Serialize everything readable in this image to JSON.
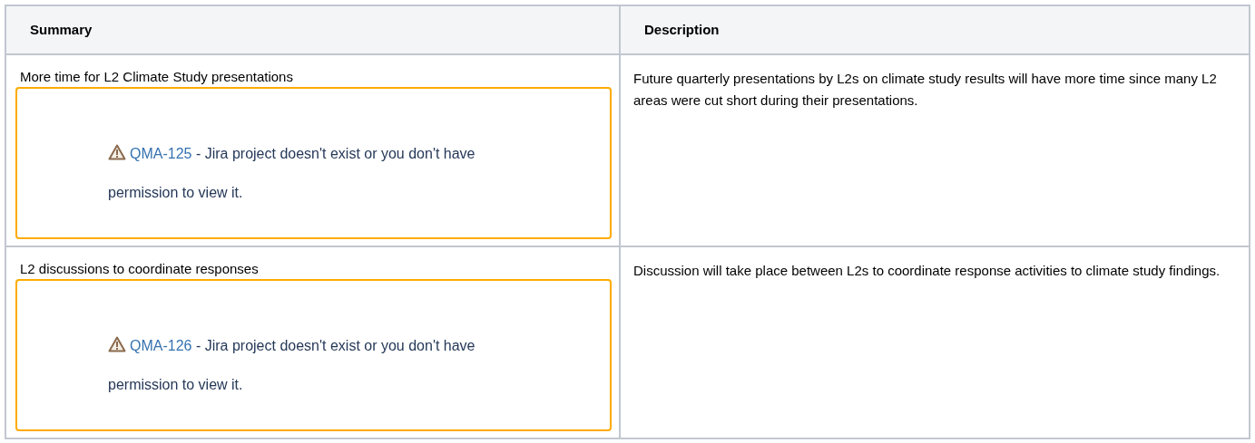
{
  "table": {
    "columns": [
      "Summary",
      "Description"
    ],
    "rows": [
      {
        "summary": "More time for L2 Climate Study presentations",
        "issue": {
          "key": "QMA-125",
          "message": " - Jira project doesn't exist or you don't have permission to view it."
        },
        "description": "Future quarterly presentations by L2s on climate study results will have more time since many L2 areas were cut short during their presentations."
      },
      {
        "summary": "L2 discussions to coordinate responses",
        "issue": {
          "key": "QMA-126",
          "message": " - Jira project doesn't exist or you don't have permission to view it."
        },
        "description": "Discussion will take place between L2s to coordinate response activities to climate study findings."
      }
    ]
  }
}
